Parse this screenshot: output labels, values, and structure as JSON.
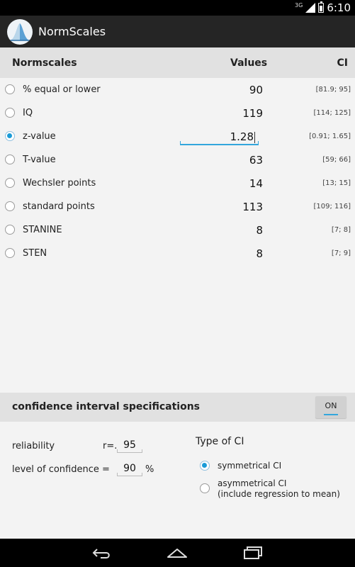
{
  "status_bar": {
    "network": "3G",
    "time": "6:10"
  },
  "app": {
    "title": "NormScales"
  },
  "table": {
    "headers": {
      "scale": "Normscales",
      "values": "Values",
      "ci": "CI"
    },
    "selected_row": "z-value",
    "rows": [
      {
        "label": "% equal or lower",
        "value": "90",
        "ci": "[81.9; 95]",
        "selected": false
      },
      {
        "label": "IQ",
        "value": "119",
        "ci": "[114; 125]",
        "selected": false
      },
      {
        "label": "z-value",
        "value": "1.28",
        "ci": "[0.91; 1.65]",
        "selected": true
      },
      {
        "label": "T-value",
        "value": "63",
        "ci": "[59; 66]",
        "selected": false
      },
      {
        "label": "Wechsler points",
        "value": "14",
        "ci": "[13; 15]",
        "selected": false
      },
      {
        "label": "standard points",
        "value": "113",
        "ci": "[109; 116]",
        "selected": false
      },
      {
        "label": "STANINE",
        "value": "8",
        "ci": "[7; 8]",
        "selected": false
      },
      {
        "label": "STEN",
        "value": "8",
        "ci": "[7; 9]",
        "selected": false
      }
    ]
  },
  "ci_specs": {
    "title": "confidence interval specifications",
    "toggle_label": "ON",
    "reliability_label": "reliability",
    "reliability_prefix": "r=.",
    "reliability_value": "95",
    "confidence_label": "level of confidence =",
    "confidence_value": "90",
    "confidence_unit": "%",
    "type_title": "Type of CI",
    "options": [
      {
        "label_line1": "symmetrical CI",
        "label_line2": "",
        "selected": true
      },
      {
        "label_line1": "asymmetrical CI",
        "label_line2": "(include regression to mean)",
        "selected": false
      }
    ]
  },
  "colors": {
    "accent": "#33a6dc",
    "action_bar": "#252525",
    "header_bg": "#e1e1e1"
  },
  "nav_icons": [
    "back-icon",
    "home-icon",
    "recent-apps-icon"
  ]
}
